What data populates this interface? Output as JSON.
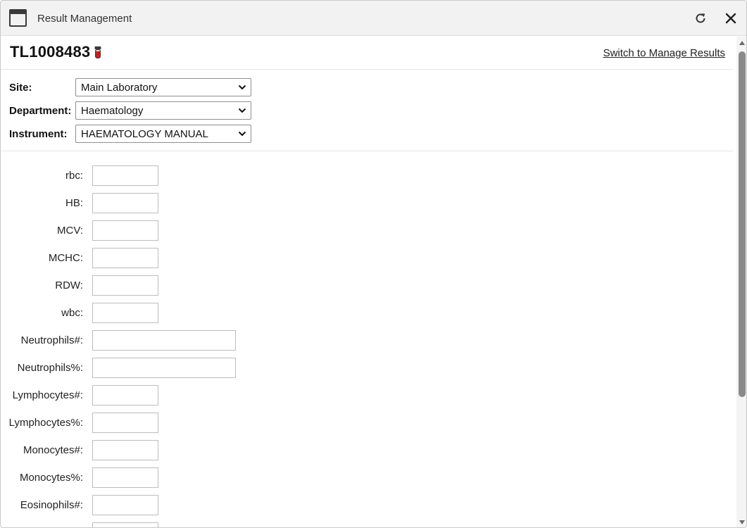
{
  "window": {
    "title": "Result Management",
    "icons": {
      "window": "window-icon",
      "refresh": "refresh-icon",
      "close": "close-icon"
    }
  },
  "header": {
    "sample_id": "TL1008483",
    "tube_icon": "blood-tube-icon",
    "tube_color": "#c81e1e",
    "switch_link": "Switch to Manage Results"
  },
  "selectors": {
    "site": {
      "label": "Site:",
      "value": "Main Laboratory"
    },
    "department": {
      "label": "Department:",
      "value": "Haematology"
    },
    "instrument": {
      "label": "Instrument:",
      "value": "HAEMATOLOGY MANUAL"
    }
  },
  "results": [
    {
      "label": "rbc:",
      "value": ""
    },
    {
      "label": "HB:",
      "value": ""
    },
    {
      "label": "MCV:",
      "value": ""
    },
    {
      "label": "MCHC:",
      "value": ""
    },
    {
      "label": "RDW:",
      "value": ""
    },
    {
      "label": "wbc:",
      "value": ""
    },
    {
      "label": "Neutrophils#:",
      "value": ""
    },
    {
      "label": "Neutrophils%:",
      "value": ""
    },
    {
      "label": "Lymphocytes#:",
      "value": ""
    },
    {
      "label": "Lymphocytes%:",
      "value": ""
    },
    {
      "label": "Monocytes#:",
      "value": ""
    },
    {
      "label": "Monocytes%:",
      "value": ""
    },
    {
      "label": "Eosinophils#:",
      "value": ""
    },
    {
      "label": "",
      "value": ""
    }
  ]
}
